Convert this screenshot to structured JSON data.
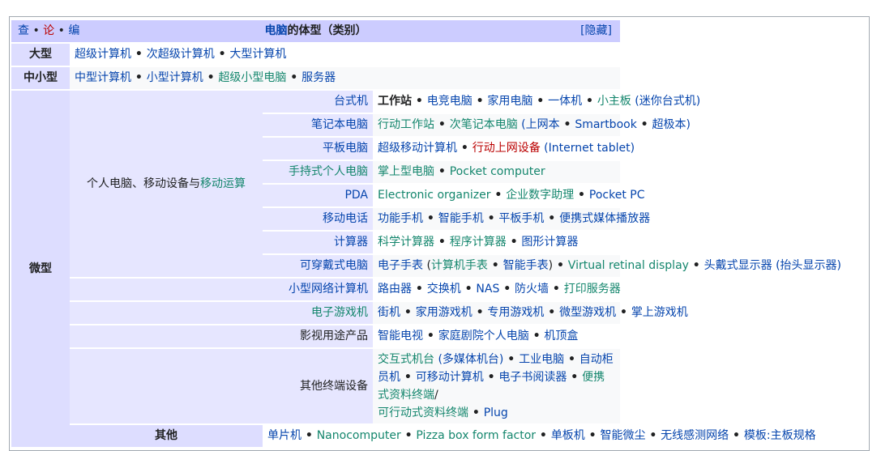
{
  "header": {
    "vde": [
      "查",
      "论",
      "编"
    ],
    "title_link": "电脑",
    "title_rest": "的体型（类别）",
    "hide_label": "[隐藏]"
  },
  "groups": {
    "large": {
      "label": "大型",
      "items": [
        "超级计算机",
        "次超级计算机",
        "大型计算机"
      ]
    },
    "medium": {
      "label": "中小型",
      "items": [
        "中型计算机",
        "小型计算机",
        "超级小型电脑",
        "服务器"
      ]
    },
    "micro": {
      "label": "微型",
      "pc_group_prefix": "个人电脑、移动设备与",
      "pc_group_link": "移动运算",
      "desktop": {
        "label": "台式机",
        "items": [
          "工作站",
          "电竞电脑",
          "家用电脑",
          "一体机",
          "小主板",
          "(迷你台式机)"
        ]
      },
      "laptop": {
        "label": "笔记本电脑",
        "items": [
          "行动工作站",
          "次笔记本电脑",
          "(上网本",
          "Smartbook",
          "超极本)"
        ]
      },
      "tablet": {
        "label": "平板电脑",
        "items": [
          "超级移动计算机",
          "行动上网设备",
          "(Internet tablet)"
        ]
      },
      "handheld": {
        "label": "手持式个人电脑",
        "items": [
          "掌上型电脑",
          "Pocket computer"
        ]
      },
      "pda": {
        "label": "PDA",
        "items": [
          "Electronic organizer",
          "企业数字助理",
          "Pocket PC"
        ]
      },
      "phone": {
        "label": "移动电话",
        "items": [
          "功能手机",
          "智能手机",
          "平板手机",
          "便携式媒体播放器"
        ]
      },
      "calc": {
        "label": "计算器",
        "items": [
          "科学计算器",
          "程序计算器",
          "图形计算器"
        ]
      },
      "wearable": {
        "label": "可穿戴式电脑",
        "items": [
          "电子手表",
          "(",
          "计算机手表",
          "智能手表",
          ")",
          "Virtual retinal display",
          "头戴式显示器",
          "(抬头显示器)"
        ]
      },
      "network": {
        "label": "小型网络计算机",
        "items": [
          "路由器",
          "交换机",
          "NAS",
          "防火墙",
          "打印服务器"
        ]
      },
      "game": {
        "label": "电子游戏机",
        "items": [
          "街机",
          "家用游戏机",
          "专用游戏机",
          "微型游戏机",
          "掌上游戏机"
        ]
      },
      "media": {
        "label": "影视用途产品",
        "items": [
          "智能电视",
          "家庭剧院个人电脑",
          "机顶盒"
        ]
      },
      "other": {
        "label": "其他终端设备",
        "items": [
          "交互式机台",
          "(多媒体机台)",
          "工业电脑",
          "自动柜员机",
          "可移动计算机",
          "电子书阅读器",
          "便携式资料终端",
          "/",
          "可行动式资料终端",
          "Plug"
        ]
      }
    },
    "others": {
      "label": "其他",
      "items": [
        "单片机",
        "Nanocomputer",
        "Pizza box form factor",
        "单板机",
        "智能微尘",
        "无线感测网络",
        "模板:主板规格"
      ]
    }
  }
}
